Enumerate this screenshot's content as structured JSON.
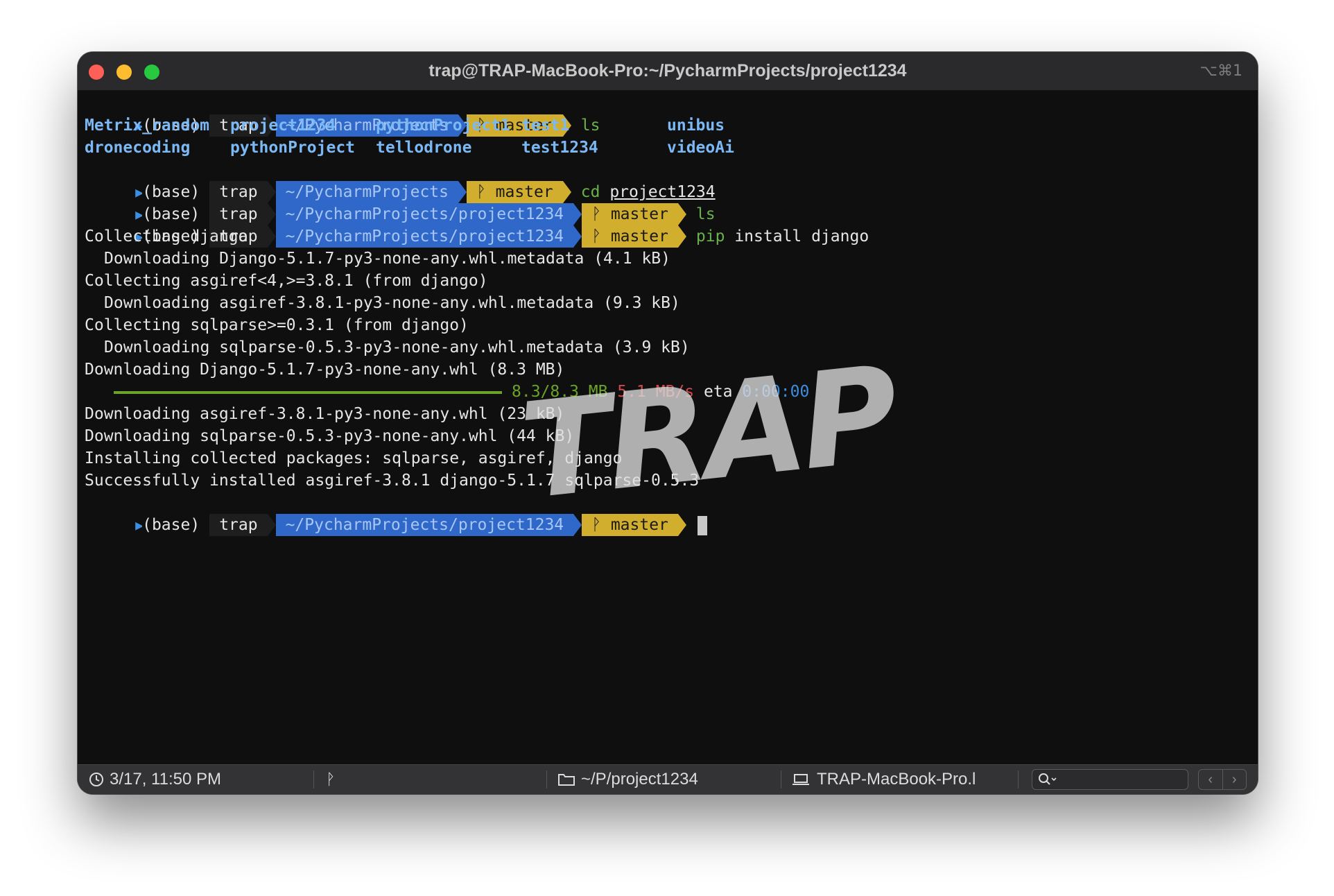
{
  "window": {
    "title": "trap@TRAP-MacBook-Pro:~/PycharmProjects/project1234",
    "shortcut": "⌥⌘1"
  },
  "prompts": {
    "base": "(base)",
    "user": "trap",
    "path_root": "~/PycharmProjects",
    "path_project": "~/PycharmProjects/project1234",
    "git_branch": "master",
    "git_icon": "git-branch-icon"
  },
  "commands": {
    "c1": "ls",
    "c2_cmd": "cd",
    "c2_arg": "project1234",
    "c3": "ls",
    "c4_cmd": "pip",
    "c4_arg": "install django"
  },
  "ls_output": {
    "row1": [
      "Metrix_random",
      "project1234",
      "pythonProject1",
      "test1",
      "unibus"
    ],
    "row2": [
      "dronecoding",
      "pythonProject",
      "tellodrone",
      "test1234",
      "videoAi"
    ]
  },
  "output": {
    "l1": "Collecting django",
    "l2": "Downloading Django-5.1.7-py3-none-any.whl.metadata (4.1 kB)",
    "l3": "Collecting asgiref<4,>=3.8.1 (from django)",
    "l4": "Downloading asgiref-3.8.1-py3-none-any.whl.metadata (9.3 kB)",
    "l5": "Collecting sqlparse>=0.3.1 (from django)",
    "l6": "Downloading sqlparse-0.5.3-py3-none-any.whl.metadata (3.9 kB)",
    "l7": "Downloading Django-5.1.7-py3-none-any.whl (8.3 MB)",
    "l9": "Downloading asgiref-3.8.1-py3-none-any.whl (23 kB)",
    "l10": "Downloading sqlparse-0.5.3-py3-none-any.whl (44 kB)",
    "l11": "Installing collected packages: sqlparse, asgiref, django",
    "l12": "Successfully installed asgiref-3.8.1 django-5.1.7 sqlparse-0.5.3"
  },
  "progress": {
    "fraction": 1.0,
    "size": "8.3/8.3 MB",
    "speed": "5.1 MB/s",
    "eta_label": "eta",
    "eta_value": "0:00:00",
    "bar_color": "#6ba32a"
  },
  "watermark": "TRAP",
  "statusbar": {
    "datetime": "3/17, 11:50 PM",
    "clock_icon": "clock-icon",
    "git_icon": "git-branch-icon",
    "folder_icon": "folder-icon",
    "directory": "~/P/project1234",
    "host_icon": "laptop-icon",
    "host": "TRAP-MacBook-Pro.l",
    "search_icon": "search-icon",
    "nav_prev": "‹",
    "nav_next": "›"
  },
  "colors": {
    "path_segment": "#2f68c8",
    "git_segment": "#d2ae2e",
    "command_green": "#6ab04c",
    "ls_directory": "#7bb8f4"
  }
}
